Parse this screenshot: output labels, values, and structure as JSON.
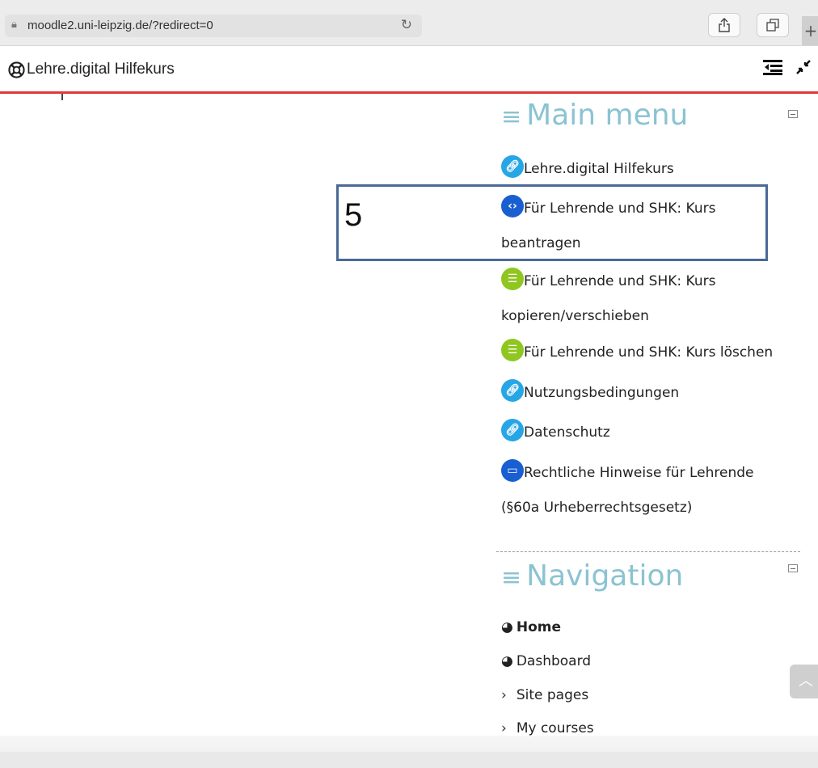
{
  "browser": {
    "url": "moodle2.uni-leipzig.de/?redirect=0"
  },
  "header": {
    "site_name": "Lehre.digital Hilfekurs"
  },
  "annotation": {
    "step_number": "5"
  },
  "main_menu": {
    "title": "Main menu",
    "items": [
      {
        "label": "Lehre.digital Hilfekurs",
        "icon": "link-icon"
      },
      {
        "label_line1": "Für Lehrende und SHK: Kurs",
        "label_line2": "beantragen",
        "icon": "code-icon"
      },
      {
        "label_line1": "Für Lehrende und SHK: Kurs",
        "label_line2": "kopieren/verschieben",
        "icon": "checklist-icon"
      },
      {
        "label": "Für Lehrende und SHK: Kurs löschen",
        "icon": "checklist-icon"
      },
      {
        "label": "Nutzungsbedingungen",
        "icon": "link-icon"
      },
      {
        "label": "Datenschutz",
        "icon": "link-icon"
      },
      {
        "label_line1": "Rechtliche Hinweise für Lehrende",
        "label_line2": "(§60a Urheberrechtsgesetz)",
        "icon": "page-icon"
      }
    ]
  },
  "navigation": {
    "title": "Navigation",
    "items": [
      {
        "label": "Home"
      },
      {
        "label": "Dashboard"
      },
      {
        "label": "Site pages"
      },
      {
        "label": "My courses"
      }
    ]
  },
  "colors": {
    "accent_red": "#e03a3a",
    "block_title": "#8bc3d2",
    "highlight_box": "#4a6996"
  }
}
